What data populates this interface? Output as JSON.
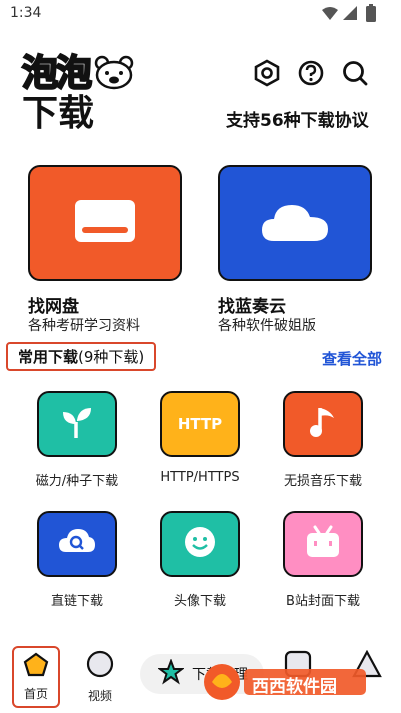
{
  "status": {
    "time": "1:34"
  },
  "brand": {
    "name": "泡泡",
    "subtitle": "下载"
  },
  "protocol_text": "支持56种下载协议",
  "cards": [
    {
      "title": "找网盘",
      "desc": "各种考研学习资料",
      "color": "#f15a29"
    },
    {
      "title": "找蓝奏云",
      "desc": "各种软件破姐版",
      "color": "#2155d6"
    }
  ],
  "section": {
    "title": "常用下载",
    "count": "(9种下载)",
    "view_all": "查看全部"
  },
  "tools": [
    {
      "label": "磁力/种子下载",
      "color": "#1fbfa5",
      "icon": "sprout-icon"
    },
    {
      "label": "HTTP/HTTPS",
      "color": "#ffb21a",
      "icon": "http-icon",
      "badge": "HTTP"
    },
    {
      "label": "无损音乐下载",
      "color": "#f15a29",
      "icon": "music-note-icon"
    },
    {
      "label": "直链下载",
      "color": "#2155d6",
      "icon": "cloud-search-icon"
    },
    {
      "label": "头像下载",
      "color": "#1fbfa5",
      "icon": "smiley-icon"
    },
    {
      "label": "B站封面下载",
      "color": "#ff8ec2",
      "icon": "bilibili-tv-icon"
    }
  ],
  "nav": {
    "home": "首页",
    "video": "视频",
    "center": "下载管理",
    "tool4": "",
    "tool5": ""
  },
  "watermark": "西西软件园"
}
